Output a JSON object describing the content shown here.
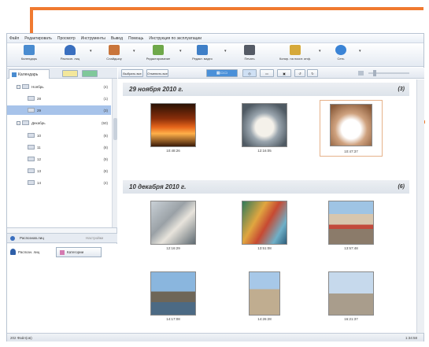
{
  "menu": [
    "Файл",
    "Редактировать",
    "Просмотр",
    "Инструменты",
    "Вывод",
    "Помощь",
    "Инструкция по эксплуатации"
  ],
  "toolbar": [
    {
      "label": "Календарь",
      "icon": "calendar-icon",
      "color": "#4a8cd0"
    },
    {
      "label": "Распозн. лиц",
      "icon": "face-person-icon",
      "color": "#3a6fbf"
    },
    {
      "label": "Слайдшоу",
      "icon": "slideshow-icon",
      "color": "#c9753b"
    },
    {
      "label": "Редактирование",
      "icon": "edit-photo-icon",
      "color": "#6fa84a"
    },
    {
      "label": "Редакт. видео",
      "icon": "video-edit-icon",
      "color": "#3f7fc7"
    },
    {
      "label": "Печать",
      "icon": "printer-icon",
      "color": "#555b66"
    },
    {
      "label": "Копир. на носит. инф.",
      "icon": "copy-media-icon",
      "color": "#d6a93a"
    },
    {
      "label": "Сеть",
      "icon": "network-globe-icon",
      "color": "#3b84d6"
    }
  ],
  "left_tab": "Календарь",
  "tree": [
    {
      "label": "Ноябрь",
      "count": "(4)",
      "level": 0,
      "expander": "−"
    },
    {
      "label": "28",
      "count": "(1)",
      "level": 1
    },
    {
      "label": "29",
      "count": "(3)",
      "level": 1,
      "selected": true
    },
    {
      "label": "Декабрь",
      "count": "(50)",
      "level": 0,
      "expander": "−"
    },
    {
      "label": "10",
      "count": "(6)",
      "level": 1
    },
    {
      "label": "11",
      "count": "(8)",
      "level": 1
    },
    {
      "label": "12",
      "count": "(9)",
      "level": 1
    },
    {
      "label": "13",
      "count": "(8)",
      "level": 1
    },
    {
      "label": "14",
      "count": "(4)",
      "level": 1
    }
  ],
  "lower_tabs": {
    "active": "Распознав.лиц",
    "other": "Настройки"
  },
  "lower_items": {
    "face": "Распозн. лиц",
    "category": "Категории"
  },
  "viewbar": {
    "select_all": "Выбрать все",
    "deselect": "Отменить все"
  },
  "groups": [
    {
      "title": "29 ноября 2010 г.",
      "count": "(3)",
      "times": [
        "10:48:26",
        "12:16:05",
        "10:47:37"
      ]
    },
    {
      "title": "10 декабря 2010 г.",
      "count": "(6)",
      "times": [
        "12:16:29",
        "13:51:08",
        "13:57:48",
        "14:17:08",
        "14:26:28",
        "16:21:37"
      ]
    }
  ],
  "status": {
    "left": "202 Файл(ов)",
    "right": "1:34:58"
  },
  "accent": "#f07a30"
}
